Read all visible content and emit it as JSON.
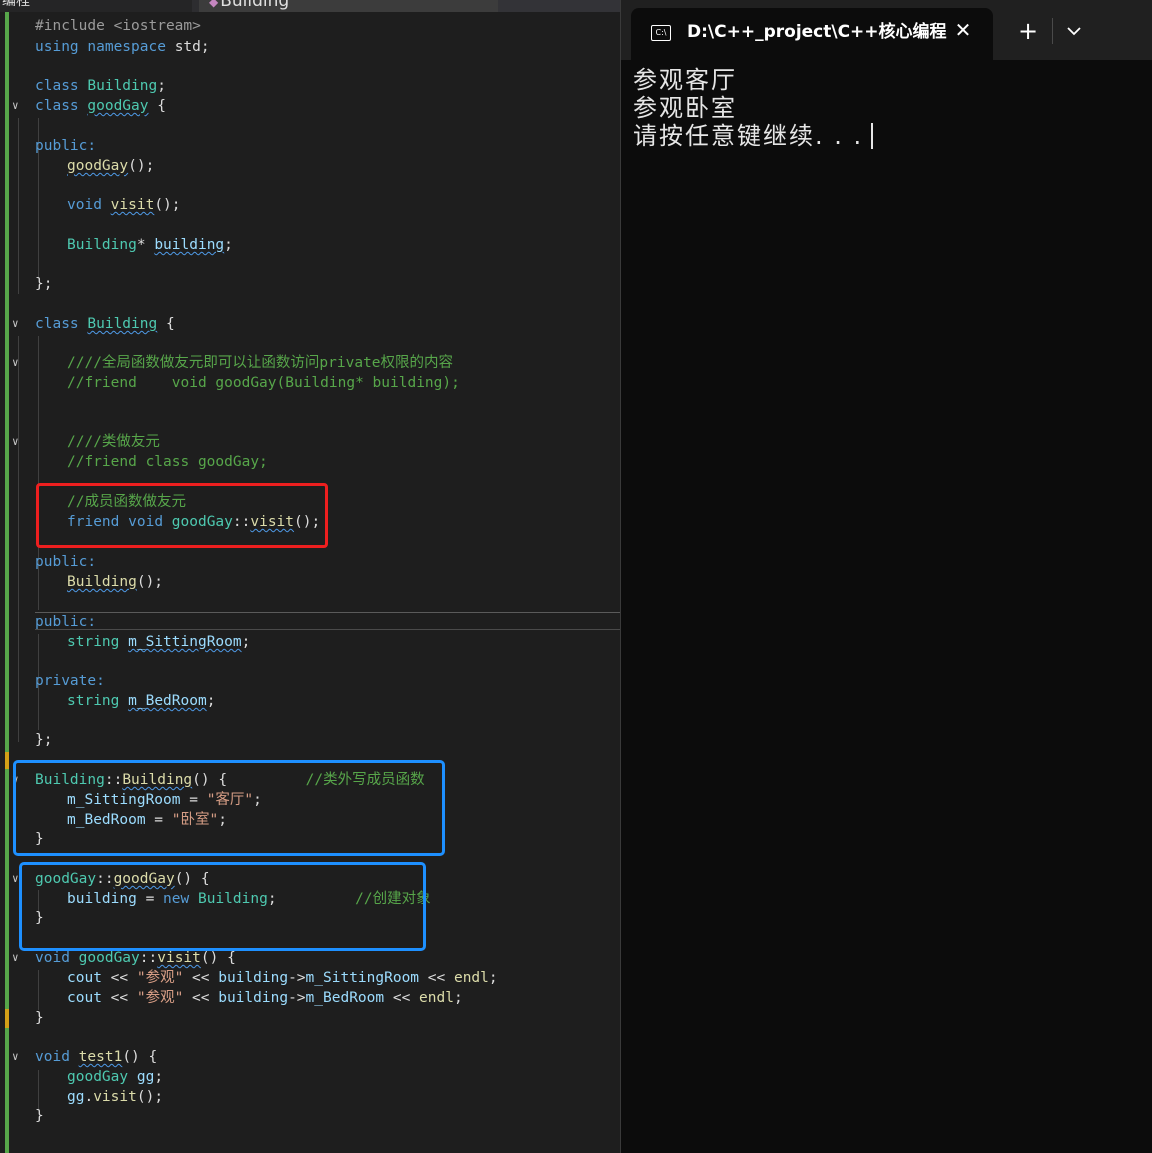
{
  "editor": {
    "tabs": {
      "left_label": "编程",
      "active_label": "Building"
    },
    "code": {
      "l01": {
        "a": "#include <iostream>"
      },
      "l02": {
        "a": "using",
        "b": "namespace",
        "c": "std;"
      },
      "l03": {
        "a": "class",
        "b": "Building",
        "c": ";"
      },
      "l04": {
        "a": "class",
        "b": "goodGay",
        "c": " {"
      },
      "l05": {
        "a": "public:"
      },
      "l06": {
        "a": "goodGay",
        "b": "();"
      },
      "l07": {
        "a": "void",
        "b": "visit",
        "c": "();"
      },
      "l08": {
        "a": "Building",
        "b": "* ",
        "c": "building",
        "d": ";"
      },
      "l09": {
        "a": "};"
      },
      "l10": {
        "a": "class",
        "b": "Building",
        "c": " {"
      },
      "l11": {
        "a": "////全局函数做友元即可以让函数访问private权限的内容"
      },
      "l12": {
        "a": "//friend    void goodGay(Building* building);"
      },
      "l13": {
        "a": "////类做友元"
      },
      "l14": {
        "a": "//friend class goodGay;"
      },
      "l15": {
        "a": "//成员函数做友元"
      },
      "l16": {
        "a": "friend",
        "b": "void",
        "c": "goodGay",
        "d": "::",
        "e": "visit",
        "f": "();"
      },
      "l17": {
        "a": "public:"
      },
      "l18": {
        "a": "Building",
        "b": "();"
      },
      "l19": {
        "a": "public:"
      },
      "l20": {
        "a": "string",
        "b": "m_SittingRoom",
        "c": ";"
      },
      "l21": {
        "a": "private:"
      },
      "l22": {
        "a": "string",
        "b": "m_BedRoom",
        "c": ";"
      },
      "l23": {
        "a": "};"
      },
      "l24": {
        "a": "Building",
        "b": "::",
        "c": "Building",
        "d": "() {",
        "e": "//类外写成员函数"
      },
      "l25": {
        "a": "m_SittingRoom",
        "b": " = ",
        "c": "\"客厅\"",
        "d": ";"
      },
      "l26": {
        "a": "m_BedRoom",
        "b": " = ",
        "c": "\"卧室\"",
        "d": ";"
      },
      "l27": {
        "a": "}"
      },
      "l28": {
        "a": "goodGay",
        "b": "::",
        "c": "goodGay",
        "d": "() {"
      },
      "l29": {
        "a": "building",
        "b": " = ",
        "c": "new",
        "d": "Building",
        "e": ";",
        "f": "//创建对象"
      },
      "l30": {
        "a": "}"
      },
      "l31": {
        "a": "void",
        "b": "goodGay",
        "c": "::",
        "d": "visit",
        "e": "() {"
      },
      "l32": {
        "a": "cout",
        "b": " << ",
        "c": "\"参观\"",
        "d": " << ",
        "e": "building",
        "f": "->",
        "g": "m_SittingRoom",
        "h": " << ",
        "i": "endl",
        "j": ";"
      },
      "l33": {
        "a": "cout",
        "b": " << ",
        "c": "\"参观\"",
        "d": " << ",
        "e": "building",
        "f": "->",
        "g": "m_BedRoom",
        "h": " << ",
        "i": "endl",
        "j": ";"
      },
      "l34": {
        "a": "}"
      },
      "l35": {
        "a": "void",
        "b": "test1",
        "c": "() {"
      },
      "l36": {
        "a": "goodGay",
        "b": "gg",
        "c": ";"
      },
      "l37": {
        "a": "gg",
        "b": ".",
        "c": "visit",
        "d": "();"
      },
      "l38": {
        "a": "}"
      }
    }
  },
  "terminal": {
    "tab_title": "D:\\C++_project\\C++核心编程",
    "tab_icon_label": "C:\\",
    "new_tab_label": "+",
    "close_label": "✕",
    "output": [
      "参观客厅",
      "参观卧室",
      "请按任意键继续. . ."
    ]
  },
  "colors": {
    "keyword": "#569cd6",
    "type": "#4ec9b0",
    "string": "#d69d85",
    "comment": "#57a64a",
    "highlight_red": "#ee1f1f",
    "highlight_blue": "#1e90ff"
  }
}
